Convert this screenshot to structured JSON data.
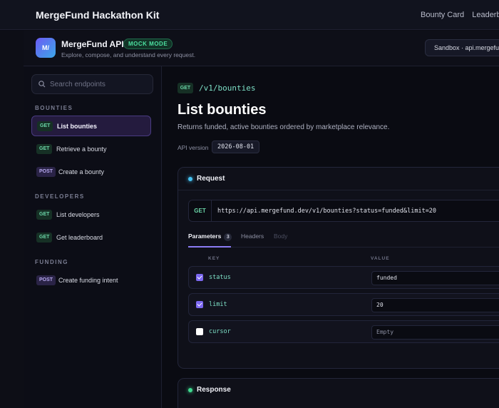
{
  "topbar": {
    "title": "MergeFund Hackathon Kit",
    "nav": [
      "Bounty Card",
      "Leaderboard"
    ]
  },
  "header": {
    "logo_text": "M/",
    "name": "MergeFund API",
    "badge": "MOCK MODE",
    "subtitle": "Explore, compose, and understand every request.",
    "environment": "Sandbox · api.mergefund.dev"
  },
  "sidebar": {
    "search_placeholder": "Search endpoints",
    "sections": [
      {
        "title": "BOUNTIES",
        "items": [
          {
            "method": "GET",
            "label": "List bounties",
            "active": true
          },
          {
            "method": "GET",
            "label": "Retrieve a bounty"
          },
          {
            "method": "POST",
            "label": "Create a bounty"
          }
        ]
      },
      {
        "title": "DEVELOPERS",
        "items": [
          {
            "method": "GET",
            "label": "List developers"
          },
          {
            "method": "GET",
            "label": "Get leaderboard"
          }
        ]
      },
      {
        "title": "FUNDING",
        "items": [
          {
            "method": "POST",
            "label": "Create funding intent"
          }
        ]
      }
    ]
  },
  "endpoint": {
    "method": "GET",
    "path": "/v1/bounties",
    "title": "List bounties",
    "description": "Returns funded, active bounties ordered by marketplace relevance.",
    "api_version_label": "API version",
    "api_version": "2026-08-01"
  },
  "request": {
    "title": "Request",
    "method": "GET",
    "url": "https://api.mergefund.dev/v1/bounties?status=funded&limit=20",
    "tabs": [
      {
        "label": "Parameters",
        "count": "3"
      },
      {
        "label": "Headers"
      },
      {
        "label": "Body"
      }
    ],
    "columns": {
      "key": "KEY",
      "value": "VALUE"
    },
    "params": [
      {
        "key": "status",
        "value": "funded",
        "enabled": true
      },
      {
        "key": "limit",
        "value": "20",
        "enabled": true
      },
      {
        "key": "cursor",
        "value": "Empty",
        "enabled": false
      }
    ]
  },
  "response": {
    "title": "Response"
  }
}
